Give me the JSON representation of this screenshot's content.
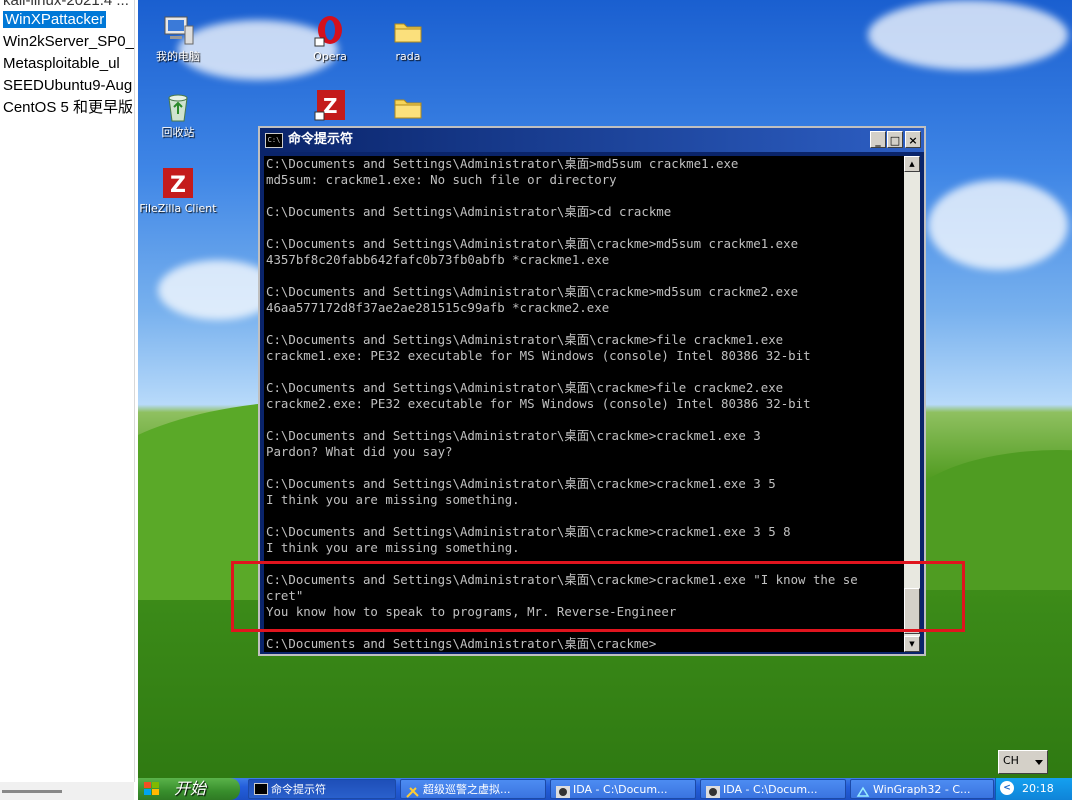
{
  "vm_list": {
    "items": [
      {
        "label": "kali-linux-2021.4 ..."
      },
      {
        "label": "WinXPattacker",
        "selected": true
      },
      {
        "label": "Win2kServer_SP0_"
      },
      {
        "label": "Metasploitable_ul"
      },
      {
        "label": "SEEDUbuntu9-Aug"
      },
      {
        "label": "CentOS 5 和更早版"
      }
    ]
  },
  "desktop": {
    "icons": [
      {
        "label": "我的电脑",
        "icon": "my-computer-icon"
      },
      {
        "label": "回收站",
        "icon": "recycle-bin-icon"
      },
      {
        "label": "FileZilla Client",
        "icon": "filezilla-icon"
      },
      {
        "label": "Opera",
        "icon": "opera-icon"
      },
      {
        "label": "rada",
        "icon": "folder-icon"
      },
      {
        "label": "",
        "icon": "filezilla-shortcut-icon"
      },
      {
        "label": "",
        "icon": "folder-icon"
      }
    ]
  },
  "cmd_window": {
    "title": "命令提示符",
    "icon_text": "C:\\",
    "minimize": "_",
    "maximize": "□",
    "close": "×",
    "content": "C:\\Documents and Settings\\Administrator\\桌面>md5sum crackme1.exe\nmd5sum: crackme1.exe: No such file or directory\n\nC:\\Documents and Settings\\Administrator\\桌面>cd crackme\n\nC:\\Documents and Settings\\Administrator\\桌面\\crackme>md5sum crackme1.exe\n4357bf8c20fabb642fafc0b73fb0abfb *crackme1.exe\n\nC:\\Documents and Settings\\Administrator\\桌面\\crackme>md5sum crackme2.exe\n46aa577172d8f37ae2ae281515c99afb *crackme2.exe\n\nC:\\Documents and Settings\\Administrator\\桌面\\crackme>file crackme1.exe\ncrackme1.exe: PE32 executable for MS Windows (console) Intel 80386 32-bit\n\nC:\\Documents and Settings\\Administrator\\桌面\\crackme>file crackme2.exe\ncrackme2.exe: PE32 executable for MS Windows (console) Intel 80386 32-bit\n\nC:\\Documents and Settings\\Administrator\\桌面\\crackme>crackme1.exe 3\nPardon? What did you say?\n\nC:\\Documents and Settings\\Administrator\\桌面\\crackme>crackme1.exe 3 5\nI think you are missing something.\n\nC:\\Documents and Settings\\Administrator\\桌面\\crackme>crackme1.exe 3 5 8\nI think you are missing something.\n\nC:\\Documents and Settings\\Administrator\\桌面\\crackme>crackme1.exe \"I know the se\ncret\"\nYou know how to speak to programs, Mr. Reverse-Engineer\n\nC:\\Documents and Settings\\Administrator\\桌面\\crackme>"
  },
  "language_bar": {
    "code": "CH"
  },
  "taskbar": {
    "start_label": "开始",
    "tasks": [
      {
        "label": "命令提示符",
        "active": true
      },
      {
        "label": "超级巡警之虚拟..."
      },
      {
        "label": "IDA - C:\\Docum..."
      },
      {
        "label": "IDA - C:\\Docum..."
      },
      {
        "label": "WinGraph32 - C..."
      }
    ],
    "clock": "20:18",
    "tray_arrow": "<"
  },
  "colors": {
    "console_text": "#c0c0c0",
    "console_bg": "#000000",
    "highlight_box": "#e0141e",
    "title_bar": "#0a246a"
  }
}
